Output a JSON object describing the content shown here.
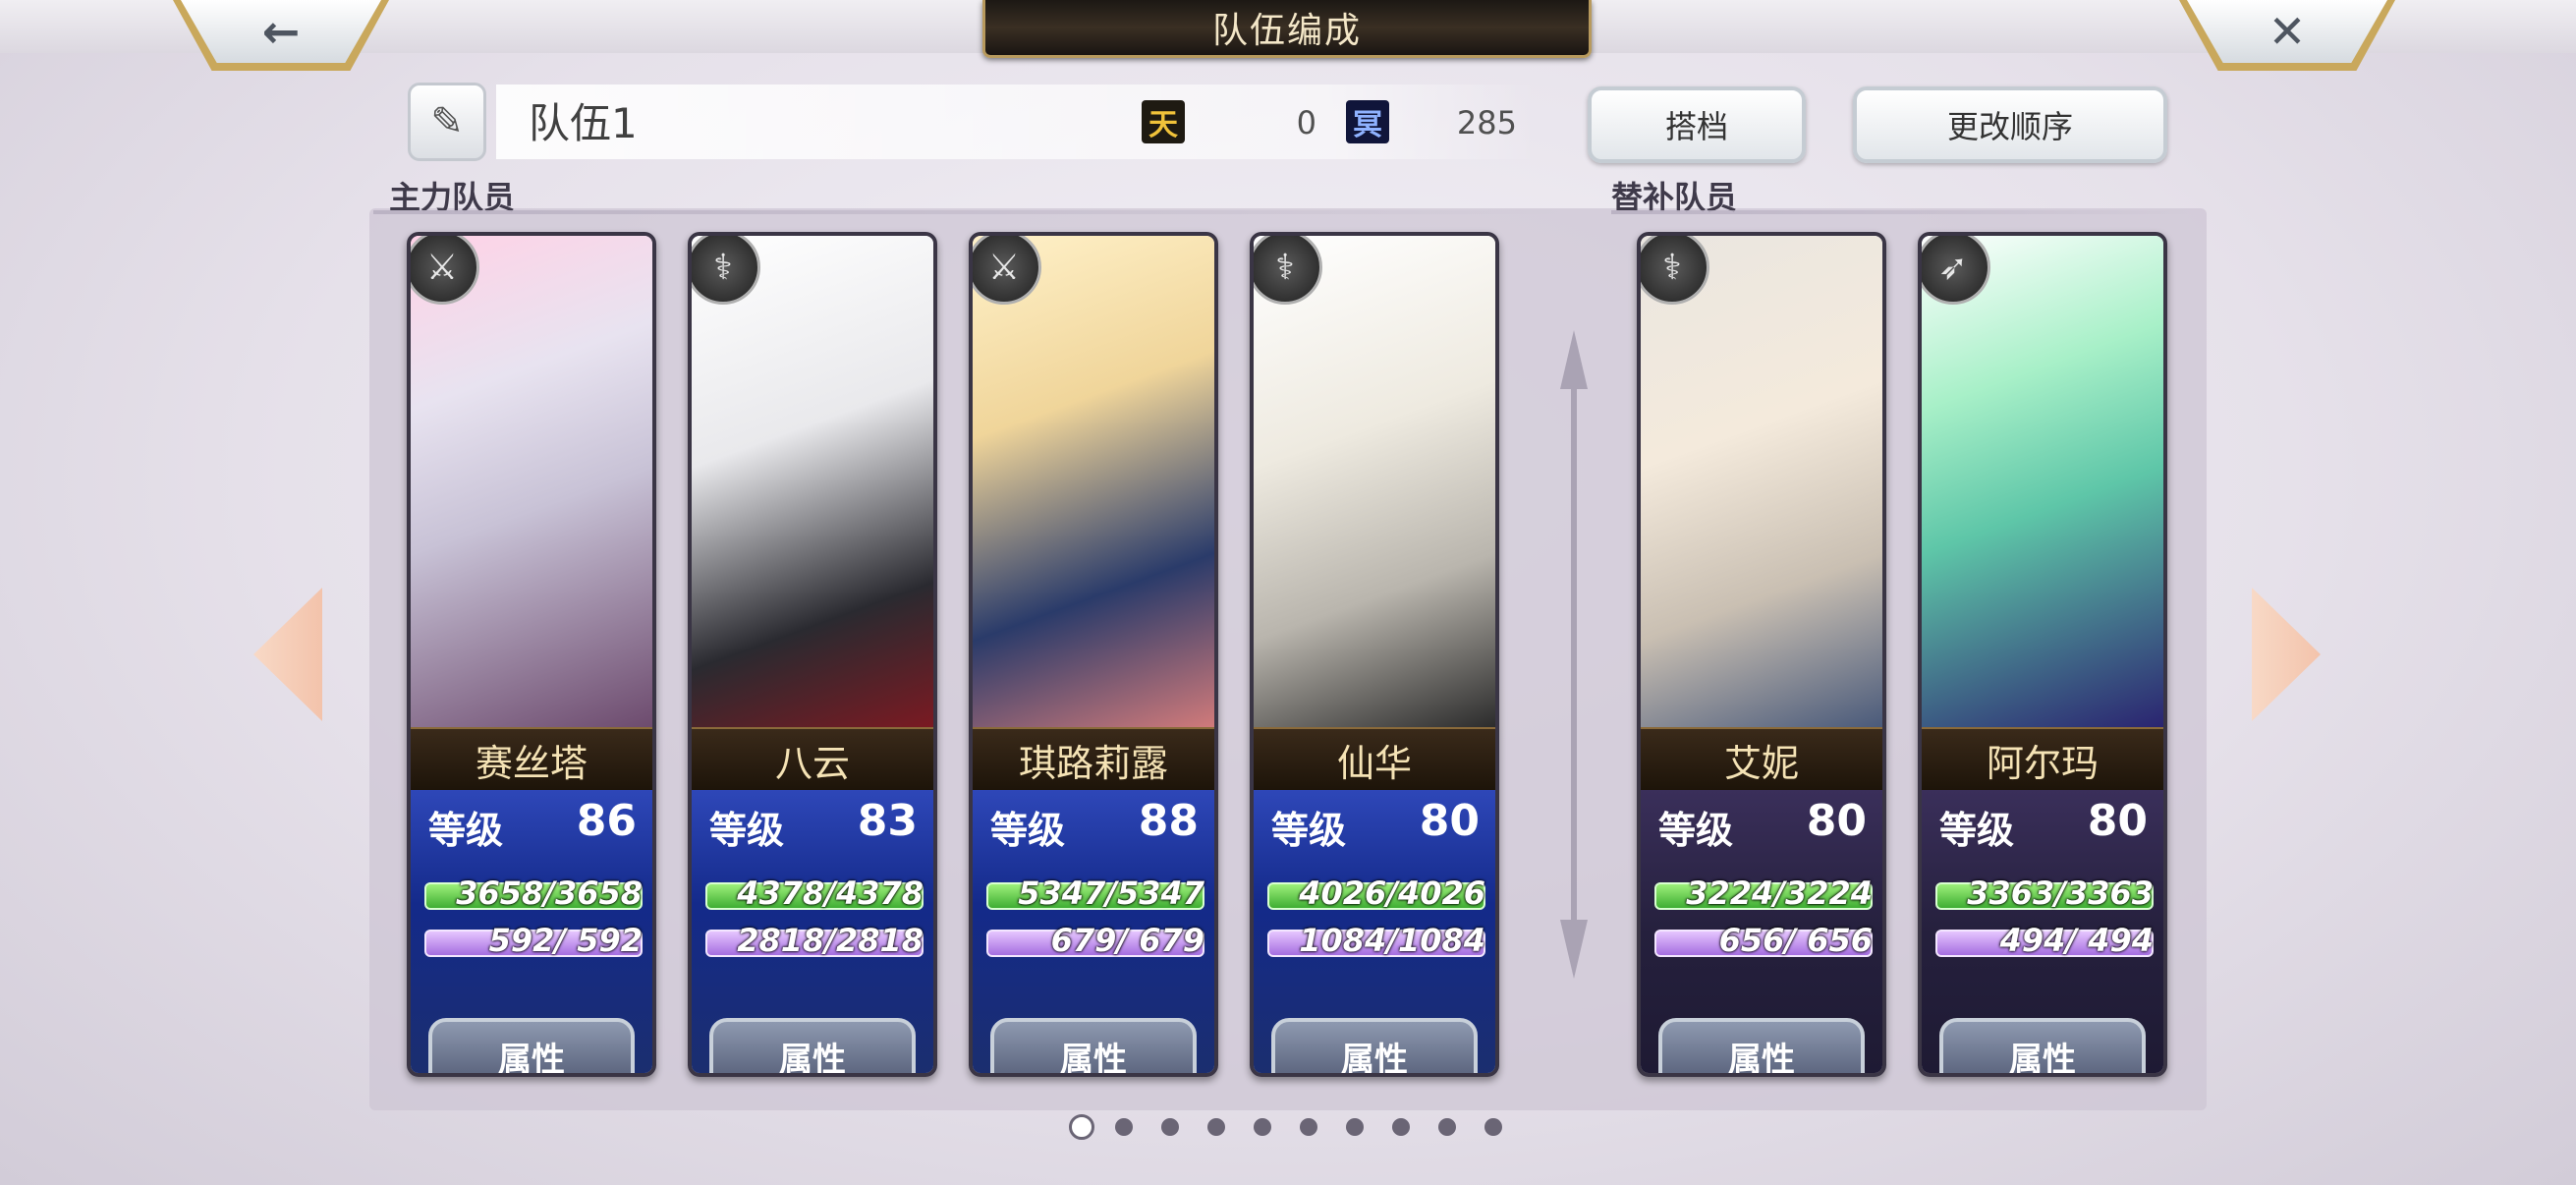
{
  "header": {
    "title": "队伍编成",
    "back_icon": "←",
    "close_icon": "✕"
  },
  "team": {
    "edit_icon": "✎",
    "name": "队伍1",
    "ten_icon_text": "天",
    "ten_value": "0",
    "ming_icon_text": "冥",
    "ming_value": "285"
  },
  "buttons": {
    "partner": "搭档",
    "reorder": "更改顺序"
  },
  "sections": {
    "main": "主力队员",
    "reserve": "替补队员"
  },
  "labels": {
    "level": "等级",
    "attributes": "属性"
  },
  "main_members": [
    {
      "name": "赛丝塔",
      "level": "86",
      "hp": "3658/3658",
      "mp": "592/ 592",
      "role_icon": "sword-icon"
    },
    {
      "name": "八云",
      "level": "83",
      "hp": "4378/4378",
      "mp": "2818/2818",
      "role_icon": "staff-icon"
    },
    {
      "name": "琪路莉露",
      "level": "88",
      "hp": "5347/5347",
      "mp": "679/ 679",
      "role_icon": "sword-icon"
    },
    {
      "name": "仙华",
      "level": "80",
      "hp": "4026/4026",
      "mp": "1084/1084",
      "role_icon": "staff-icon"
    }
  ],
  "reserve_members": [
    {
      "name": "艾妮",
      "level": "80",
      "hp": "3224/3224",
      "mp": "656/ 656",
      "role_icon": "staff-icon"
    },
    {
      "name": "阿尔玛",
      "level": "80",
      "hp": "3363/3363",
      "mp": "494/ 494",
      "role_icon": "bow-icon"
    }
  ],
  "pagination": {
    "pages": 10,
    "current": 1
  },
  "colors": {
    "title_plate": "#2b231a",
    "gold_border": "#b89a5e",
    "main_stats_bg": "#1c3494",
    "reserve_stats_bg": "#2a2444",
    "hp_bar": "#5bc444",
    "mp_bar": "#b88ae8"
  }
}
